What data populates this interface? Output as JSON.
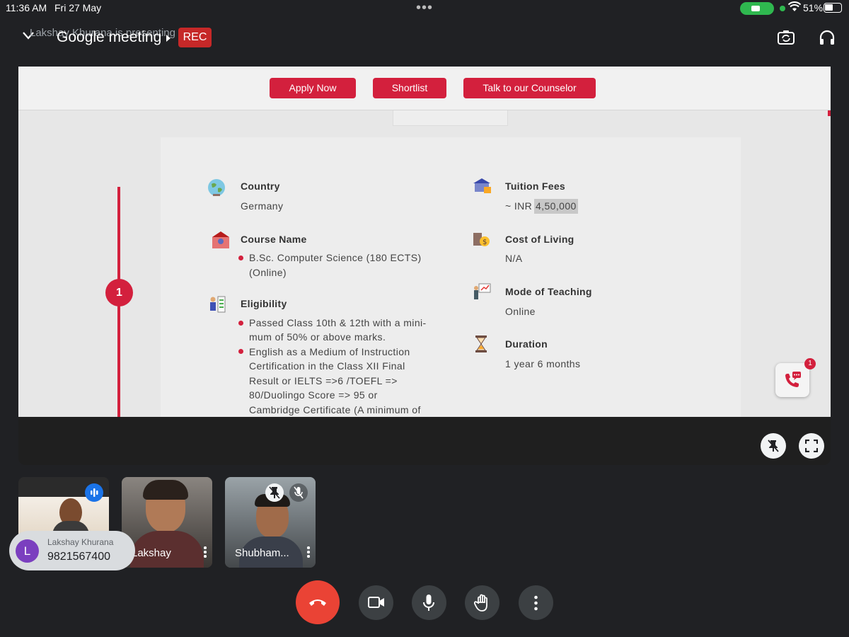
{
  "status_bar": {
    "time": "11:36 AM",
    "date": "Fri 27 May",
    "battery": "51%"
  },
  "meeting": {
    "presenting_text": "Lakshay Khurana is presenting",
    "title": "Google meeting",
    "rec_label": "REC"
  },
  "slide": {
    "buttons": {
      "apply": "Apply Now",
      "shortlist": "Shortlist",
      "counselor": "Talk to our Counselor"
    },
    "step_number": "1",
    "country": {
      "label": "Country",
      "value": "Germany"
    },
    "course": {
      "label": "Course Name",
      "lines": [
        "B.Sc. Computer Science (180 ECTS)",
        "(Online)"
      ]
    },
    "eligibility": {
      "label": "Eligibility",
      "item1_lines": [
        "Passed Class 10th & 12th with a mini-",
        "mum of 50% or above marks."
      ],
      "item2_lines": [
        "English as a Medium of Instruction",
        "Certification in the Class XII Final",
        "Result or IELTS =>6 /TOEFL =>",
        "80/Duolingo Score => 95 or",
        "Cambridge Certificate (A minimum of"
      ]
    },
    "tuition": {
      "label": "Tuition Fees",
      "prefix": "~ INR",
      "amount": "4,50,000"
    },
    "cost_of_living": {
      "label": "Cost of Living",
      "value": "N/A"
    },
    "mode": {
      "label": "Mode of Teaching",
      "value": "Online"
    },
    "duration": {
      "label": "Duration",
      "value": "1 year 6 months"
    },
    "chat_badge": "1"
  },
  "participants": [
    {
      "name": ""
    },
    {
      "name": "Lakshay"
    },
    {
      "name": "Shubham..."
    }
  ],
  "toast": {
    "initial": "L",
    "name": "Lakshay Khurana",
    "number": "9821567400"
  },
  "colors": {
    "accent": "#d3203d",
    "end_call": "#ea4335",
    "background": "#202124"
  }
}
